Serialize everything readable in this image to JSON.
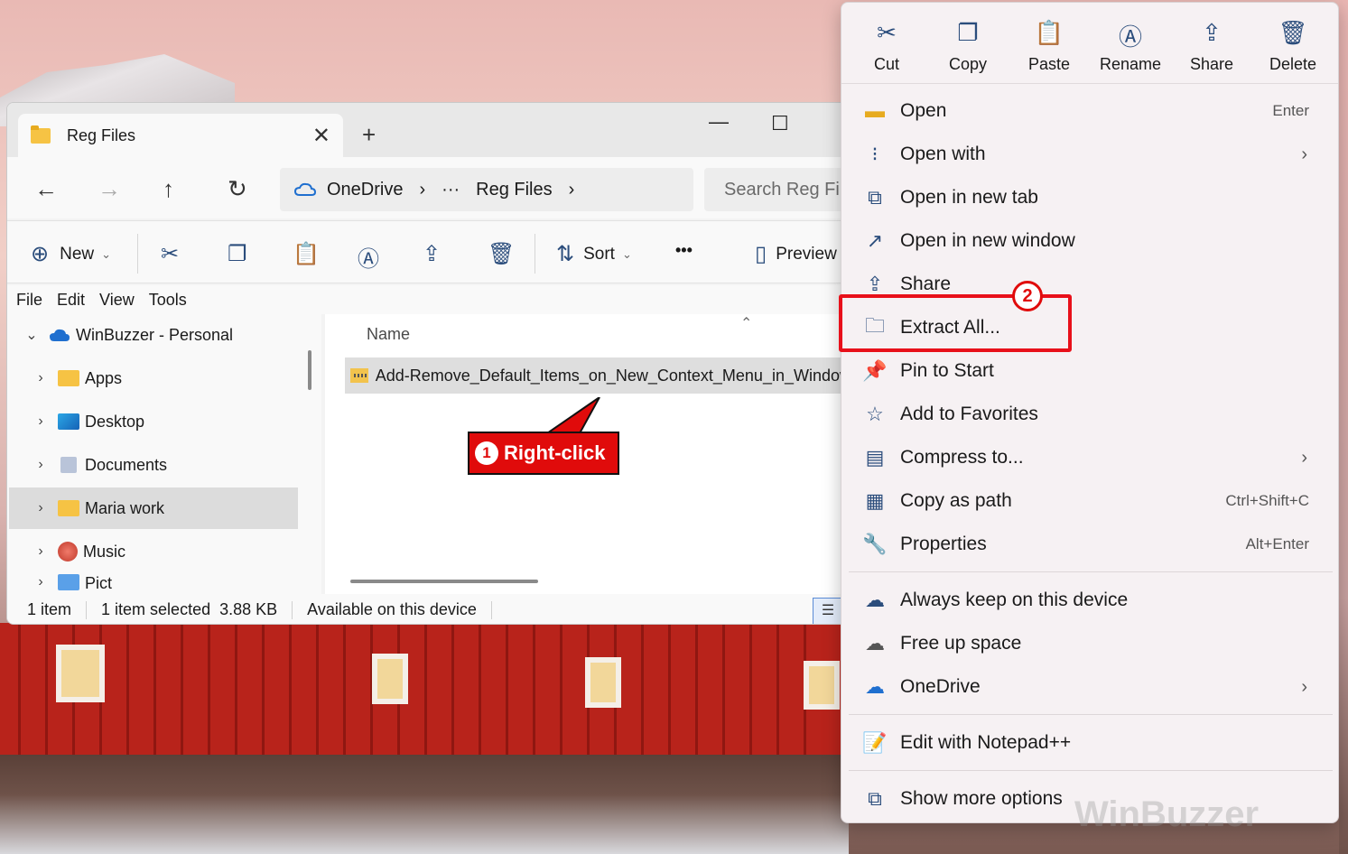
{
  "explorer": {
    "tab_title": "Reg Files",
    "address": {
      "root": "OneDrive",
      "ellipsis": "···",
      "folder": "Reg Files"
    },
    "search_placeholder": "Search Reg Fil",
    "toolbar": {
      "new_label": "New",
      "sort_label": "Sort",
      "more_label": "•••",
      "preview_label": "Preview"
    },
    "menubar": [
      "File",
      "Edit",
      "View",
      "Tools"
    ],
    "sidebar": [
      {
        "label": "WinBuzzer - Personal",
        "icon": "onedrive-icon",
        "expanded": true
      },
      {
        "label": "Apps",
        "icon": "folder-icon"
      },
      {
        "label": "Desktop",
        "icon": "desktop-icon"
      },
      {
        "label": "Documents",
        "icon": "documents-icon"
      },
      {
        "label": "Maria work",
        "icon": "folder-icon",
        "selected": true
      },
      {
        "label": "Music",
        "icon": "music-icon"
      },
      {
        "label": "Pict",
        "icon": "pictures-icon"
      }
    ],
    "column_name": "Name",
    "file_name": "Add-Remove_Default_Items_on_New_Context_Menu_in_Windows",
    "status": {
      "count": "1 item",
      "selected": "1 item selected",
      "size": "3.88 KB",
      "availability": "Available on this device"
    }
  },
  "callout1": {
    "number": "1",
    "text": "Right-click"
  },
  "context_menu": {
    "actions": [
      {
        "label": "Cut",
        "icon": "scissors-icon"
      },
      {
        "label": "Copy",
        "icon": "copy-icon"
      },
      {
        "label": "Paste",
        "icon": "paste-icon"
      },
      {
        "label": "Rename",
        "icon": "rename-icon"
      },
      {
        "label": "Share",
        "icon": "share-icon"
      },
      {
        "label": "Delete",
        "icon": "trash-icon"
      }
    ],
    "items": [
      {
        "label": "Open",
        "shortcut": "Enter",
        "icon": "folder-open-icon"
      },
      {
        "label": "Open with",
        "submenu": true,
        "icon": "open-with-icon"
      },
      {
        "label": "Open in new tab",
        "icon": "new-tab-icon"
      },
      {
        "label": "Open in new window",
        "icon": "new-window-icon"
      },
      {
        "label": "Share",
        "icon": "share-icon"
      },
      {
        "label": "Extract All...",
        "icon": "extract-icon"
      },
      {
        "label": "Pin to Start",
        "icon": "pin-icon"
      },
      {
        "label": "Add to Favorites",
        "icon": "star-icon"
      },
      {
        "label": "Compress to...",
        "submenu": true,
        "icon": "compress-icon"
      },
      {
        "label": "Copy as path",
        "shortcut": "Ctrl+Shift+C",
        "icon": "copy-path-icon"
      },
      {
        "label": "Properties",
        "shortcut": "Alt+Enter",
        "icon": "wrench-icon"
      },
      {
        "label": "Always keep on this device",
        "icon": "cloud-sync-icon"
      },
      {
        "label": "Free up space",
        "icon": "cloud-icon"
      },
      {
        "label": "OneDrive",
        "submenu": true,
        "icon": "onedrive-icon"
      },
      {
        "label": "Edit with Notepad++",
        "icon": "notepadpp-icon"
      },
      {
        "label": "Show more options",
        "icon": "more-options-icon"
      }
    ]
  },
  "badge2": "2",
  "watermark": "WinBuzzer",
  "colors": {
    "accent": "#e00b0b",
    "icon_blue": "#2b4d7c",
    "menu_bg": "#f6f1f3"
  }
}
